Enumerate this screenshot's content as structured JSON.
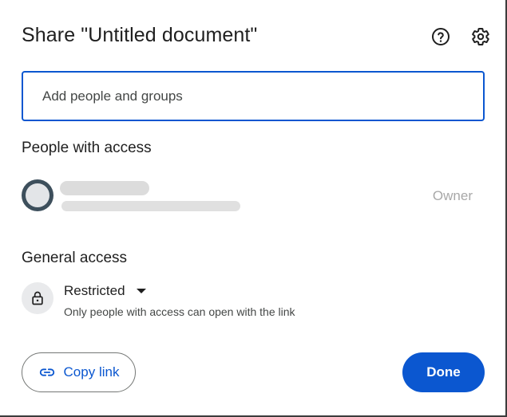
{
  "dialog": {
    "title": "Share \"Untitled document\"",
    "help_icon": "help-circle-icon",
    "settings_icon": "gear-icon"
  },
  "share_input": {
    "placeholder": "Add people and groups",
    "value": ""
  },
  "people_with_access": {
    "heading": "People with access",
    "people": [
      {
        "name": "",
        "email": "",
        "role": "Owner",
        "name_redacted": true
      }
    ]
  },
  "general_access": {
    "heading": "General access",
    "icon": "lock-icon",
    "selected": "Restricted",
    "description": "Only people with access can open with the link"
  },
  "footer": {
    "copy_link_label": "Copy link",
    "copy_link_icon": "link-icon",
    "done_label": "Done"
  },
  "colors": {
    "accent": "#0b57d0",
    "text": "#1f1f1f",
    "muted": "#444746",
    "role": "#a8a8a8"
  }
}
